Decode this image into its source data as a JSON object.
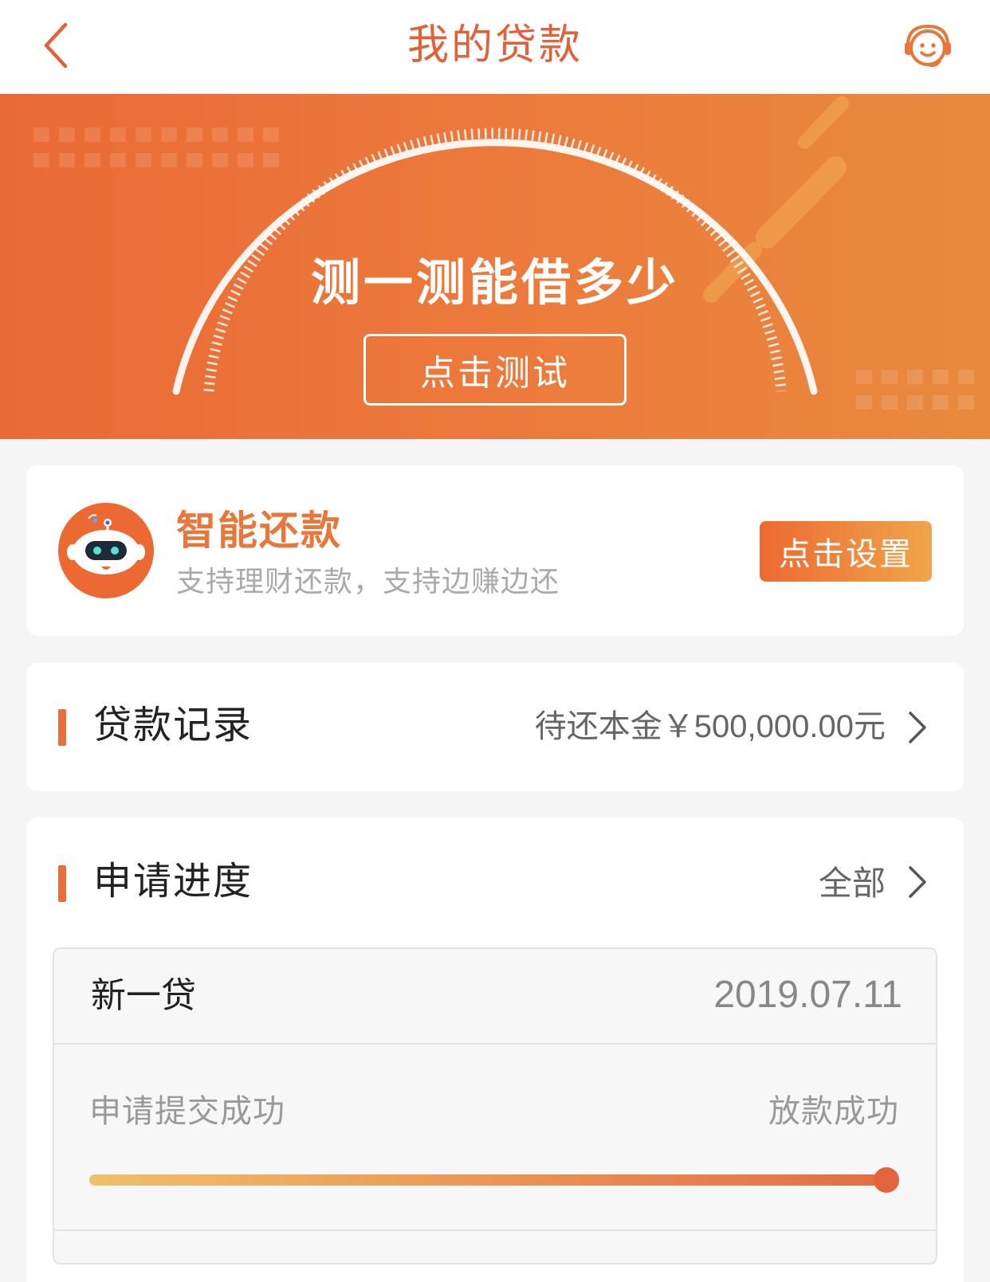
{
  "header": {
    "title": "我的贷款",
    "back_icon": "chevron-left-icon",
    "service_icon": "customer-service-icon"
  },
  "banner": {
    "title": "测一测能借多少",
    "button_label": "点击测试"
  },
  "smart_repay": {
    "title": "智能还款",
    "subtitle": "支持理财还款，支持边赚边还",
    "button_label": "点击设置",
    "avatar_icon": "robot-icon"
  },
  "loan_record": {
    "title": "贷款记录",
    "amount_text": "待还本金￥500,000.00元"
  },
  "progress": {
    "title": "申请进度",
    "all_label": "全部",
    "application": {
      "name": "新一贷",
      "date": "2019.07.11",
      "step_start": "申请提交成功",
      "step_end": "放款成功",
      "progress_fraction": 1.0
    }
  },
  "colors": {
    "accent": "#e86e3a",
    "title_orange": "#e2603a",
    "banner_start": "#ea6a35",
    "banner_end": "#e88a3e"
  }
}
